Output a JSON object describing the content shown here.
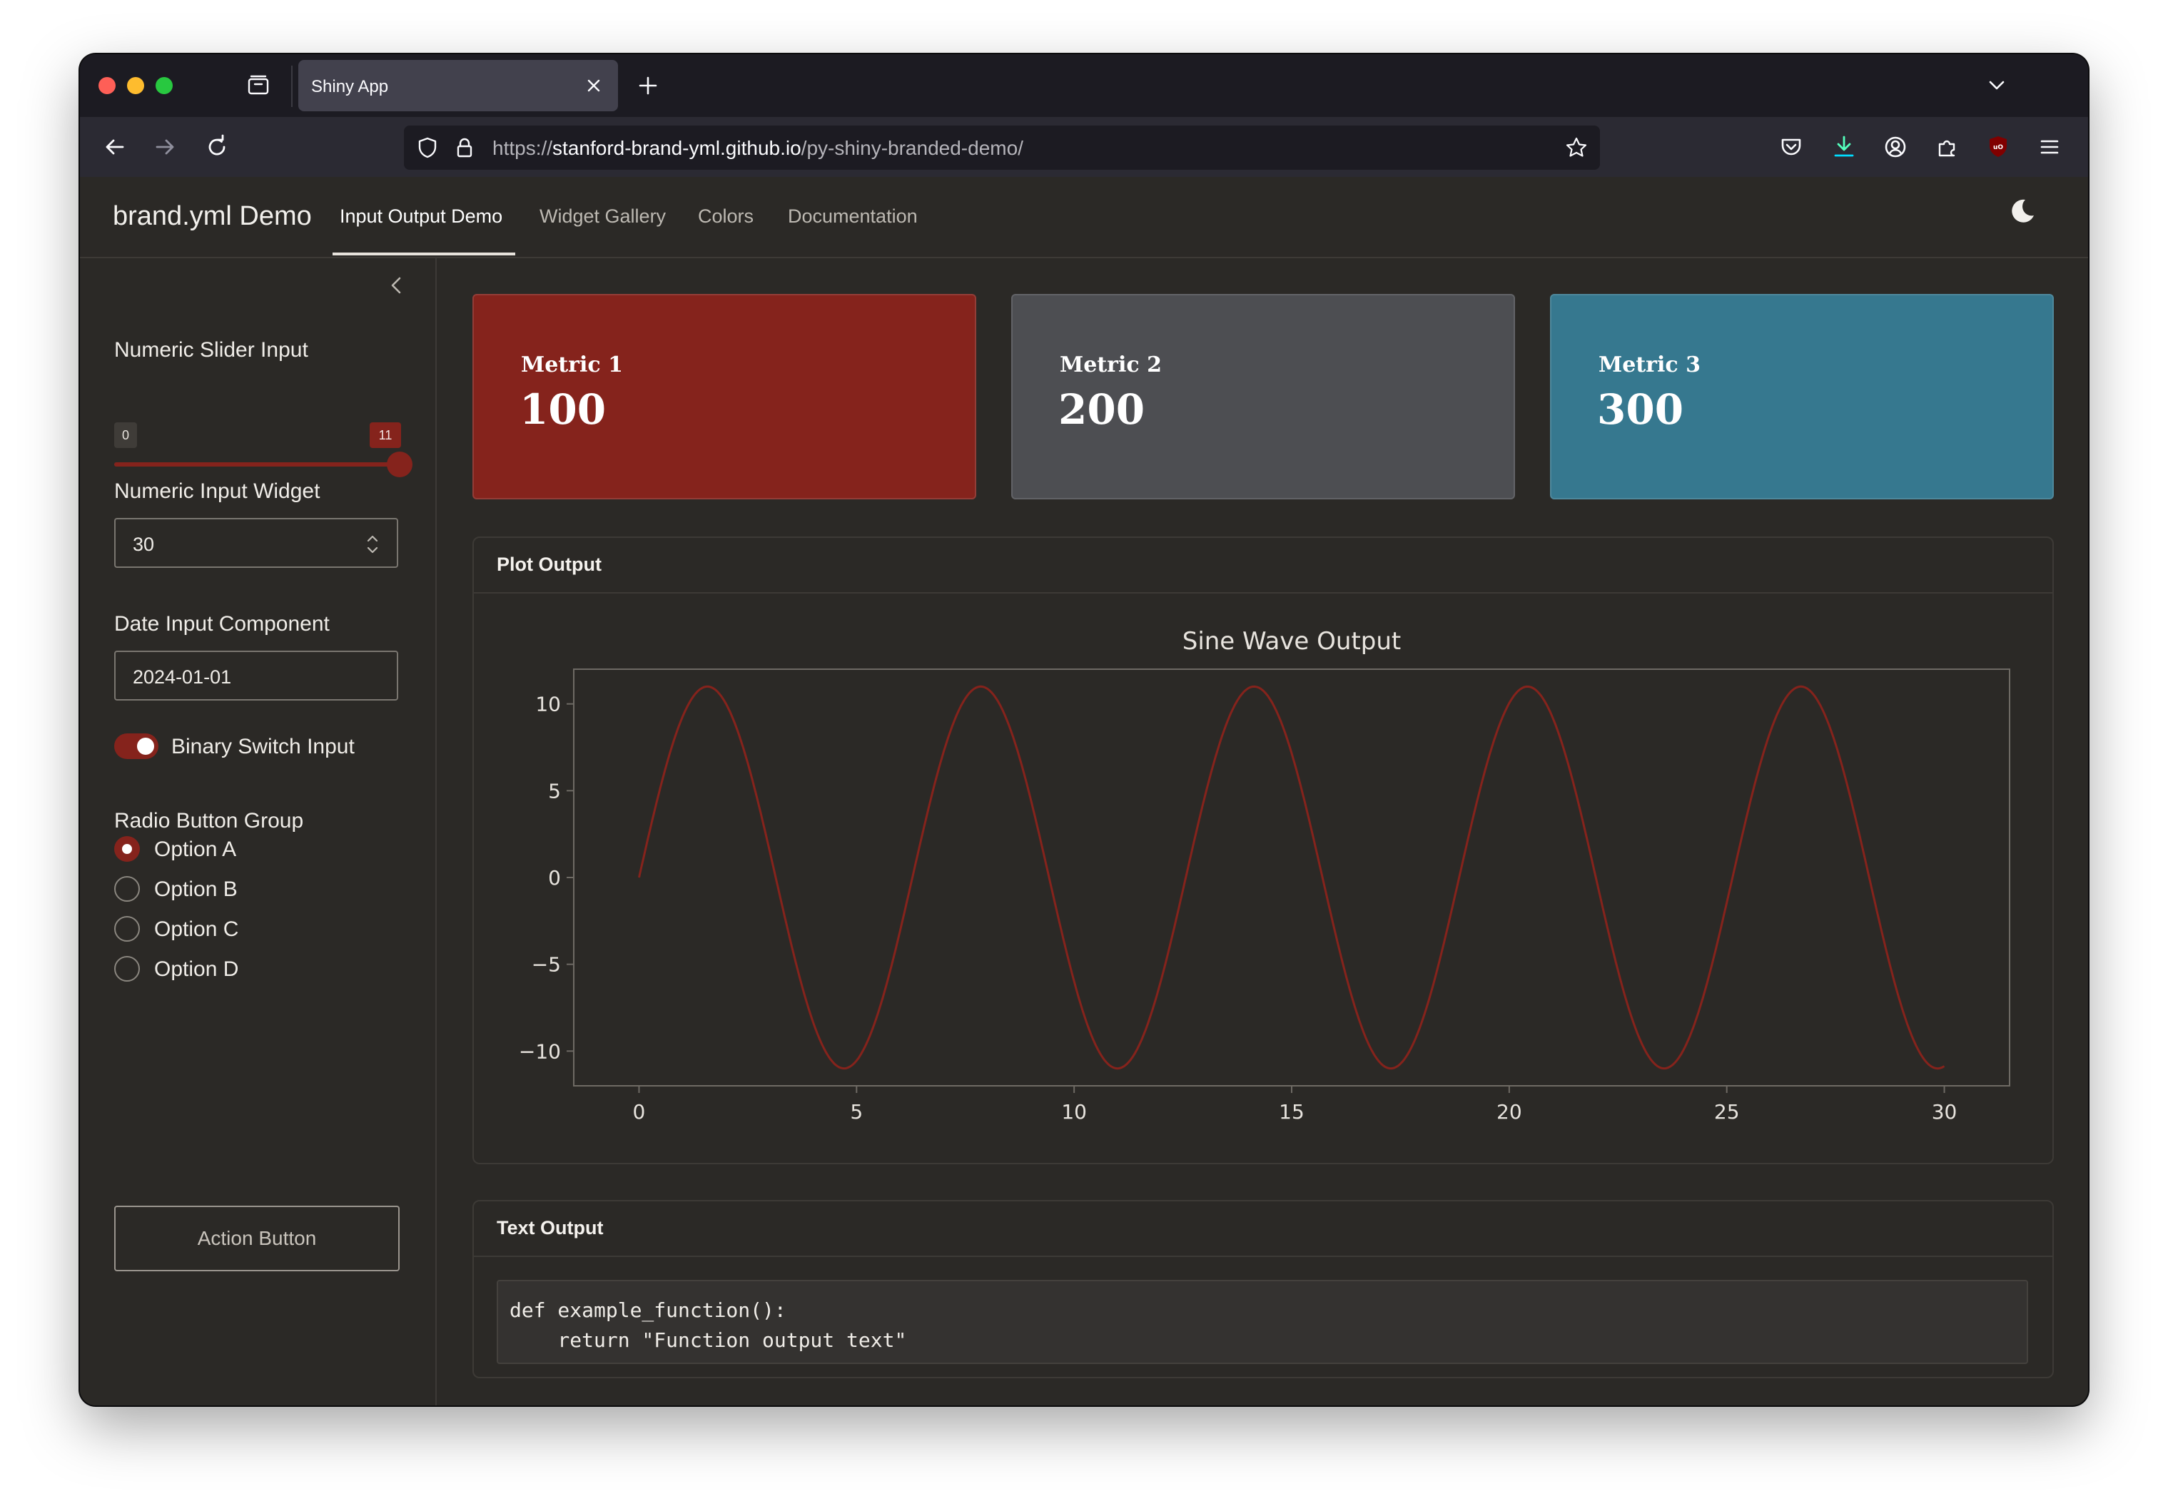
{
  "browser": {
    "tab_title": "Shiny App",
    "url_prefix": "https://",
    "url_host": "stanford-brand-yml.github.io",
    "url_path": "/py-shiny-branded-demo/"
  },
  "app": {
    "brand": "brand.yml Demo",
    "nav": [
      "Input Output Demo",
      "Widget Gallery",
      "Colors",
      "Documentation"
    ],
    "active_nav": "Input Output Demo",
    "theme_toggle_icon": "moon-icon"
  },
  "sidebar": {
    "slider": {
      "label": "Numeric Slider Input",
      "min": "0",
      "max": "11",
      "value": 11,
      "min_value": 0,
      "max_value": 11
    },
    "numeric_input": {
      "label": "Numeric Input Widget",
      "value": "30"
    },
    "date_input": {
      "label": "Date Input Component",
      "value": "2024-01-01"
    },
    "switch": {
      "label": "Binary Switch Input",
      "on": true
    },
    "radio": {
      "label": "Radio Button Group",
      "options": [
        "Option A",
        "Option B",
        "Option C",
        "Option D"
      ],
      "selected": "Option A"
    },
    "action_button": "Action Button"
  },
  "metrics": [
    {
      "title": "Metric 1",
      "value": "100",
      "color": "#85231c"
    },
    {
      "title": "Metric 2",
      "value": "200",
      "color": "#4d4e52"
    },
    {
      "title": "Metric 3",
      "value": "300",
      "color": "#36788f"
    }
  ],
  "plot_card": {
    "header": "Plot Output"
  },
  "text_card": {
    "header": "Text Output",
    "code": [
      "def example_function():",
      "    return \"Function output text\""
    ]
  },
  "chart_data": {
    "type": "line",
    "title": "Sine Wave Output",
    "function": "y = 11 * sin(x)",
    "amplitude": 11,
    "x_range": [
      0,
      30
    ],
    "xlim": [
      -1.5,
      31.5
    ],
    "ylim": [
      -12,
      12
    ],
    "xticks": [
      0,
      5,
      10,
      15,
      20,
      25,
      30
    ],
    "yticks": [
      10,
      5,
      0,
      -5,
      -10
    ],
    "ytick_labels": [
      "10",
      "5",
      "0",
      "−5",
      "−10"
    ],
    "line_color": "#85231c",
    "grid": false
  }
}
